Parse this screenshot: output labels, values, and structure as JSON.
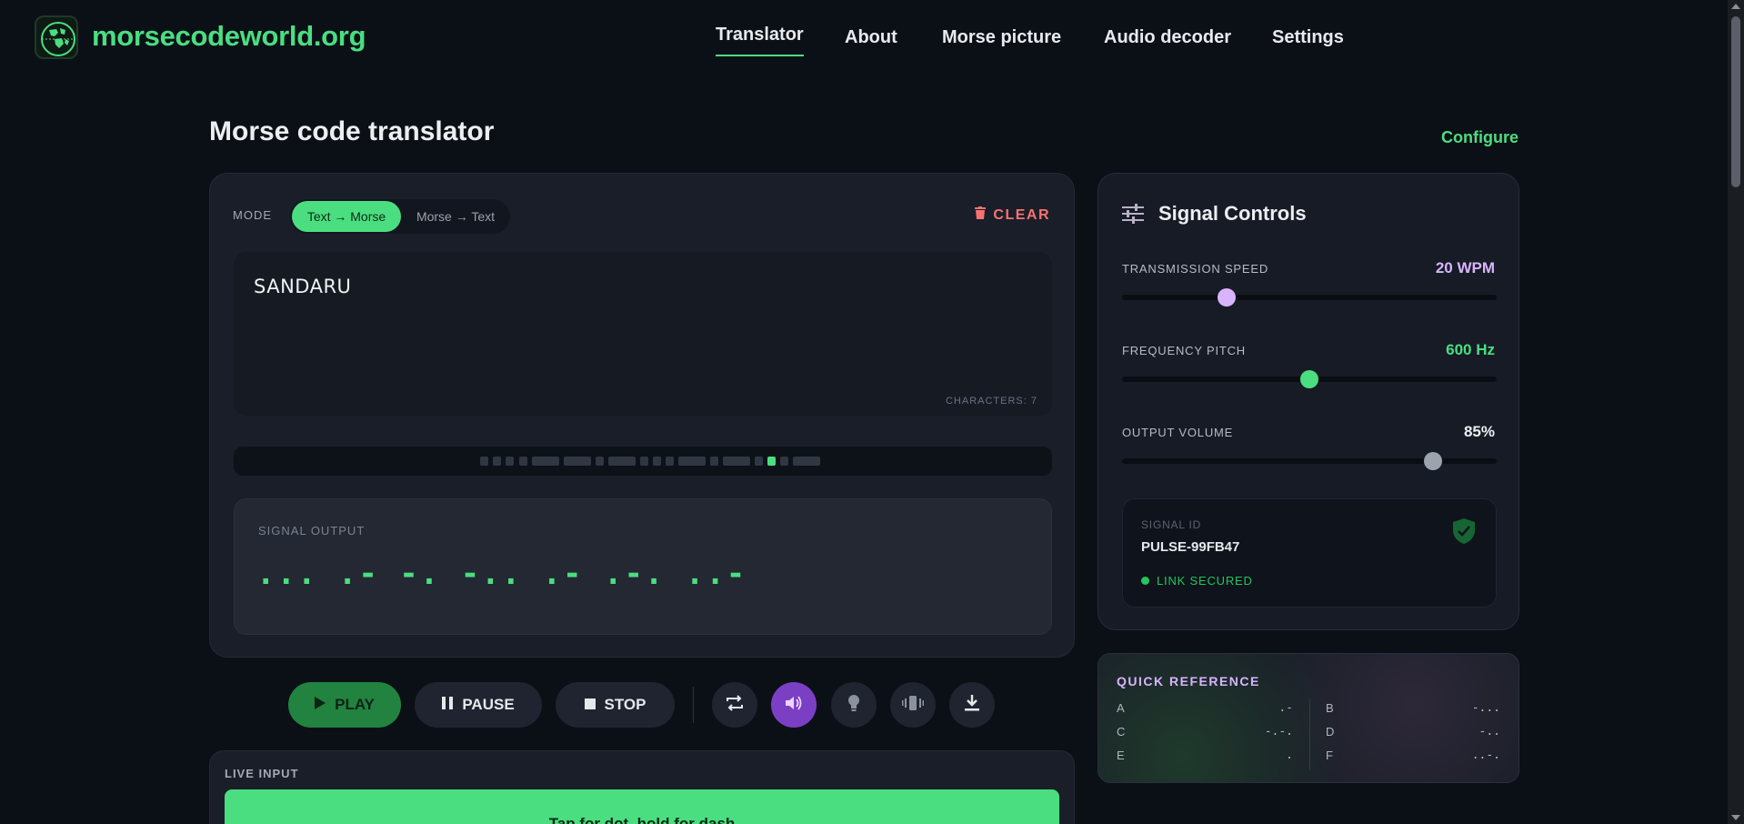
{
  "brand": {
    "name": "morsecodeworld.org",
    "logo_icon": "globe-icon"
  },
  "nav": {
    "items": [
      {
        "label": "Translator",
        "active": true
      },
      {
        "label": "About",
        "active": false
      },
      {
        "label": "Morse picture",
        "active": false
      },
      {
        "label": "Audio decoder",
        "active": false
      },
      {
        "label": "Settings",
        "active": false
      }
    ]
  },
  "page": {
    "title": "Morse code translator",
    "configure_label": "Configure"
  },
  "translator": {
    "mode_label": "MODE",
    "mode_options": [
      "Text → Morse",
      "Morse → Text"
    ],
    "mode_selected": "Text → Morse",
    "clear_label": "CLEAR",
    "input_text": "SANDARU",
    "characters_label": "CHARACTERS: 7",
    "output_label": "SIGNAL OUTPUT",
    "output_morse": "... .- -. -.. .- .-. ..-"
  },
  "controls": {
    "play_label": "PLAY",
    "pause_label": "PAUSE",
    "stop_label": "STOP",
    "icon_buttons": [
      "repeat-icon",
      "speaker-icon",
      "lightbulb-icon",
      "vibrate-icon",
      "download-icon"
    ]
  },
  "live_input": {
    "label": "LIVE INPUT",
    "tap_text": "Tap for dot, hold for dash"
  },
  "signal_controls": {
    "title": "Signal Controls",
    "speed": {
      "label": "TRANSMISSION SPEED",
      "value": "20 WPM",
      "level": 0.28
    },
    "frequency": {
      "label": "FREQUENCY PITCH",
      "value": "600 Hz",
      "level": 0.5
    },
    "volume": {
      "label": "OUTPUT VOLUME",
      "value": "85%",
      "level": 0.83
    },
    "signal_id_label": "SIGNAL ID",
    "signal_id_value": "PULSE-99FB47",
    "link_status": "LINK SECURED"
  },
  "quick_reference": {
    "title": "QUICK REFERENCE",
    "entries": [
      {
        "letter": "A",
        "code": ".-"
      },
      {
        "letter": "B",
        "code": "-..."
      },
      {
        "letter": "C",
        "code": "-.-."
      },
      {
        "letter": "D",
        "code": "-.."
      },
      {
        "letter": "E",
        "code": "."
      },
      {
        "letter": "F",
        "code": "..-."
      }
    ]
  },
  "colors": {
    "accent_green": "#4ade80",
    "accent_purple": "#d8b4fe",
    "danger_red": "#f87171",
    "background": "#0b1017",
    "card": "#1a1e28"
  }
}
